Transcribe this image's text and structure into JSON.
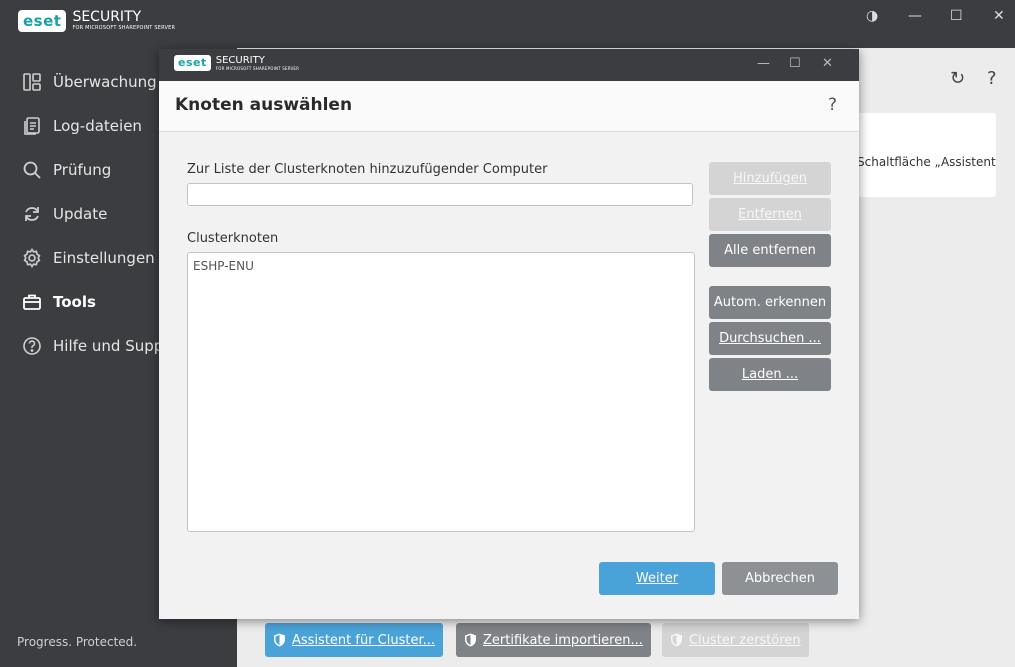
{
  "app": {
    "logo": "eset",
    "product": "SECURITY",
    "product_sub": "FOR MICROSOFT SHAREPOINT SERVER",
    "tagline": "Progress. Protected.",
    "window_controls": [
      "◑",
      "—",
      "☐",
      "✕"
    ]
  },
  "sidebar": {
    "items": [
      {
        "label": "Überwachung",
        "icon": "dashboard-icon",
        "active": false
      },
      {
        "label": "Log-dateien",
        "icon": "log-files-icon",
        "active": false
      },
      {
        "label": "Prüfung",
        "icon": "search-icon",
        "active": false
      },
      {
        "label": "Update",
        "icon": "refresh-icon",
        "active": false
      },
      {
        "label": "Einstellungen",
        "icon": "gear-icon",
        "active": false
      },
      {
        "label": "Tools",
        "icon": "briefcase-icon",
        "active": true
      },
      {
        "label": "Hilfe und Support",
        "icon": "help-circle-icon",
        "active": false
      }
    ]
  },
  "main": {
    "refresh_icon": "↻",
    "help_icon": "?",
    "card_text": "Schaltfläche „Assistent",
    "bottom_buttons": [
      {
        "label": "Assistent für Cluster...",
        "color": "#4aa3d8",
        "enabled": true
      },
      {
        "label": "Zertifikate importieren...",
        "color": "#7f8287",
        "enabled": true
      },
      {
        "label": "Cluster zerstören",
        "color": "#d4d4d4",
        "enabled": false
      }
    ]
  },
  "dialog": {
    "logo": "eset",
    "product": "SECURITY",
    "product_sub": "FOR MICROSOFT SHAREPOINT SERVER",
    "window_controls": [
      "—",
      "☐",
      "✕"
    ],
    "title": "Knoten auswählen",
    "help": "?",
    "computer_label": "Zur Liste der Clusterknoten hinzuzufügender Computer",
    "computer_value": "",
    "nodes_label": "Clusterknoten",
    "nodes": [
      "ESHP-ENU"
    ],
    "side_buttons": [
      {
        "label": "Hinzufügen",
        "enabled": false
      },
      {
        "label": "Entfernen",
        "enabled": false
      },
      {
        "label": "Alle entfernen",
        "enabled": true
      },
      {
        "label": "Autom. erkennen",
        "enabled": true
      },
      {
        "label": "Durchsuchen ...",
        "enabled": true
      },
      {
        "label": "Laden ...",
        "enabled": true
      }
    ],
    "next_label": "Weiter",
    "cancel_label": "Abbrechen",
    "colors": {
      "primary": "#4aa3d8",
      "secondary": "#7f8287",
      "disabled": "#d4d4d4"
    }
  }
}
